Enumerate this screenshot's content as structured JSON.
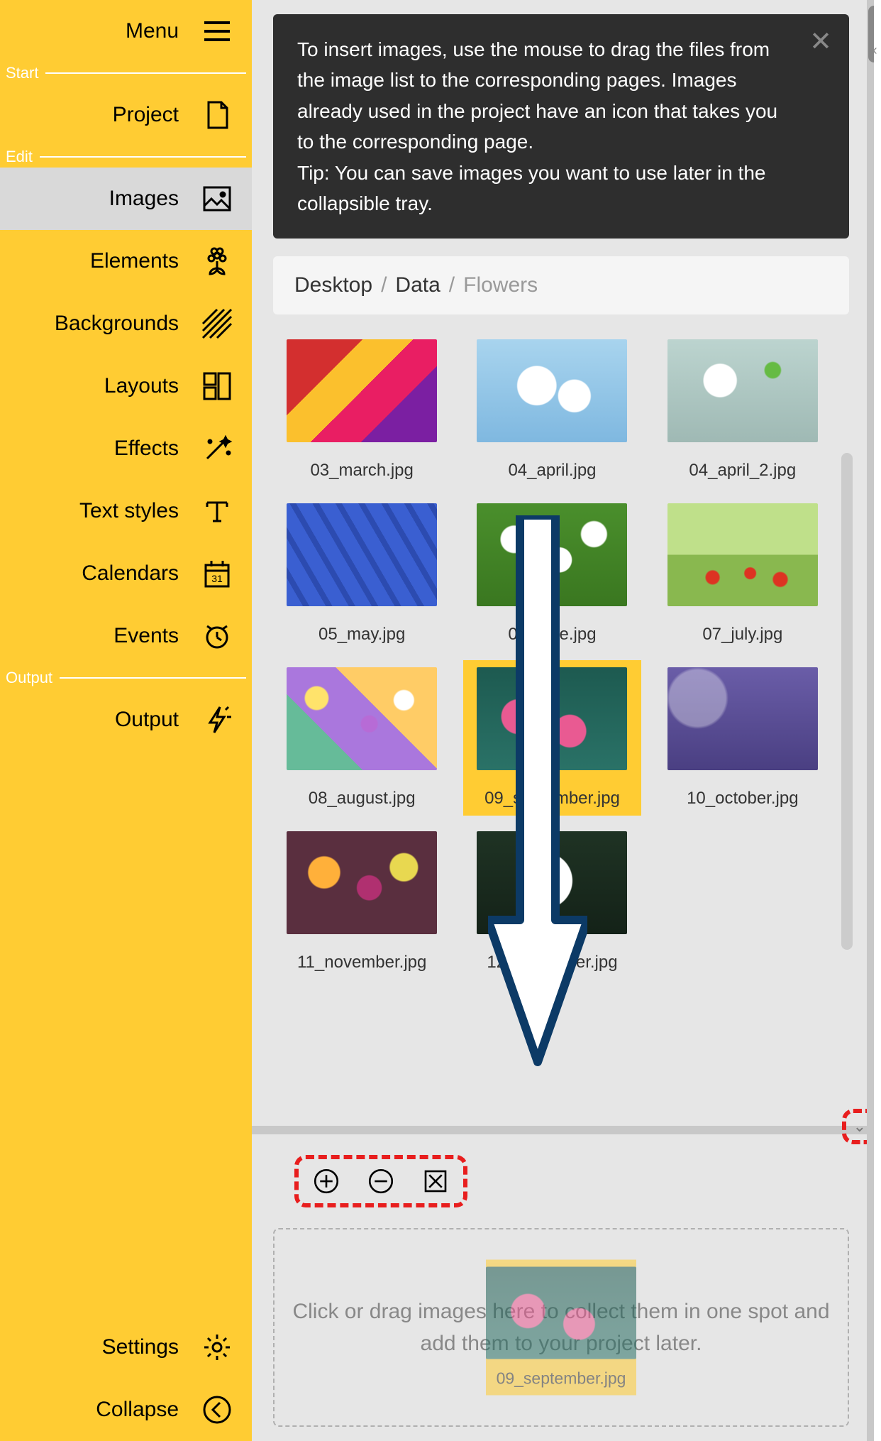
{
  "sidebar": {
    "menu_label": "Menu",
    "sections": {
      "start": "Start",
      "edit": "Edit",
      "output": "Output"
    },
    "items": {
      "project": "Project",
      "images": "Images",
      "elements": "Elements",
      "backgrounds": "Backgrounds",
      "layouts": "Layouts",
      "effects": "Effects",
      "text_styles": "Text styles",
      "calendars": "Calendars",
      "events": "Events",
      "output": "Output",
      "settings": "Settings",
      "collapse": "Collapse"
    }
  },
  "help": {
    "text": "To insert images, use the mouse to drag the files from the image list to the corresponding pages. Images already used in the project have an icon that takes you to the corresponding page.\nTip: You can save images you want to use later in the collapsible tray."
  },
  "breadcrumbs": {
    "items": [
      "Desktop",
      "Data",
      "Flowers"
    ],
    "sep": "/"
  },
  "gallery": {
    "items": [
      {
        "file": "03_march.jpg",
        "thumb": "t-march"
      },
      {
        "file": "04_april.jpg",
        "thumb": "t-april1"
      },
      {
        "file": "04_april_2.jpg",
        "thumb": "t-april2"
      },
      {
        "file": "05_may.jpg",
        "thumb": "t-may"
      },
      {
        "file": "06_june.jpg",
        "thumb": "t-june"
      },
      {
        "file": "07_july.jpg",
        "thumb": "t-july"
      },
      {
        "file": "08_august.jpg",
        "thumb": "t-aug"
      },
      {
        "file": "09_september.jpg",
        "thumb": "t-sep",
        "selected": true
      },
      {
        "file": "10_october.jpg",
        "thumb": "t-oct"
      },
      {
        "file": "11_november.jpg",
        "thumb": "t-nov"
      },
      {
        "file": "12_december.jpg",
        "thumb": "t-dec"
      }
    ]
  },
  "tray": {
    "drop_hint": "Click or drag images here to collect them in one spot and add them to your project later.",
    "ghost_file": "09_september.jpg"
  }
}
